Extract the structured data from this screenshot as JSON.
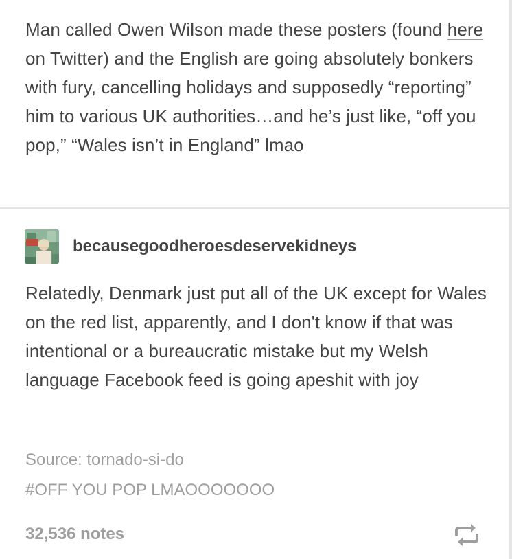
{
  "post": {
    "body_pre_link": "Man called Owen Wilson made these posters (found ",
    "body_link": "here",
    "body_post_link": " on Twitter) and the English are going absolutely bonkers with fury, cancelling holidays and supposedly “reporting” him to various UK authorities…and he’s just like, “off you pop,” “Wales isn’t in England” lmao"
  },
  "reblog": {
    "username": "becausegoodheroesdeservekidneys",
    "body": "Relatedly, Denmark just put all of the UK except for Wales on the red list, apparently, and I don't know if that was intentional or a bureaucratic mistake but my Welsh language Facebook feed is going apeshit with joy"
  },
  "footer": {
    "source": "Source: tornado-si-do",
    "tag": "#OFF YOU POP LMAOOOOOOO",
    "notes": "32,536 notes",
    "reblog_icon": "reblog-icon"
  },
  "colors": {
    "text": "#444444",
    "muted": "#9e9e9e",
    "divider": "#e4e4e4"
  }
}
